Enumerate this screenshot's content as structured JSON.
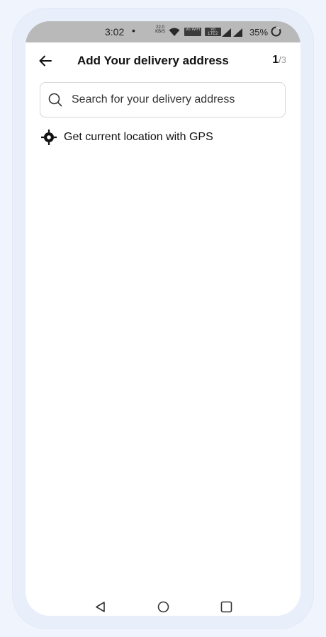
{
  "status_bar": {
    "time": "3:02",
    "dot": "•",
    "net_speed_value": "22.0",
    "net_speed_unit": "KB/S",
    "volte_1": "Vo WiFi",
    "volte_2": "Vo LTE2",
    "battery_percent": "35%"
  },
  "header": {
    "title": "Add Your delivery address",
    "step_current": "1",
    "step_separator": "/",
    "step_total": "3"
  },
  "search": {
    "placeholder": "Search for your delivery address",
    "value": ""
  },
  "gps": {
    "label": "Get current location with GPS",
    "icon": "gps-target-icon"
  },
  "icons": {
    "back": "arrow-left-icon",
    "search": "search-icon",
    "nav_back": "triangle-back-icon",
    "nav_home": "circle-home-icon",
    "nav_recents": "square-recents-icon"
  },
  "colors": {
    "status_bar_bg": "#b9b9b9",
    "screen_bg": "#ffffff",
    "page_bg": "#f0f4fc",
    "text_primary": "#111111",
    "text_muted": "#9a9a9a"
  }
}
